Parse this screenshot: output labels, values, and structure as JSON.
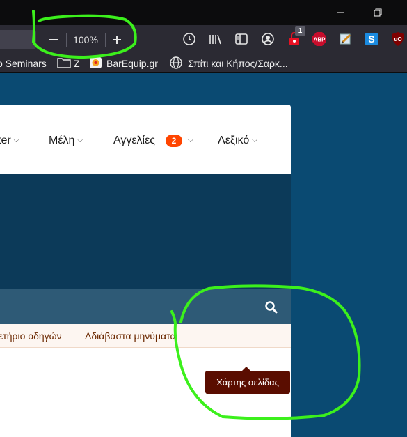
{
  "browser": {
    "zoom_level": "100%",
    "extension_badge_count": "1",
    "bookmarks": [
      {
        "label": "o Seminars"
      },
      {
        "label": "Z"
      },
      {
        "label": "BarEquip.gr"
      },
      {
        "label": "Σπίτι και Κήπος/Σαρκ..."
      }
    ]
  },
  "site": {
    "nav": [
      {
        "label": "ter"
      },
      {
        "label": "Μέλη"
      },
      {
        "label": "Αγγελίες",
        "badge": "2"
      },
      {
        "label": "Λεξικό"
      }
    ],
    "subnav": [
      {
        "label": "ετήριο οδηγών"
      },
      {
        "label": "Αδιάβαστα μηνύματα"
      }
    ],
    "tooltip": "Χάρτης σελίδας"
  },
  "colors": {
    "page_background": "#0a4a72",
    "annotation": "#3cf01c",
    "badge": "#ff4500",
    "tooltip": "#5a0d00"
  }
}
